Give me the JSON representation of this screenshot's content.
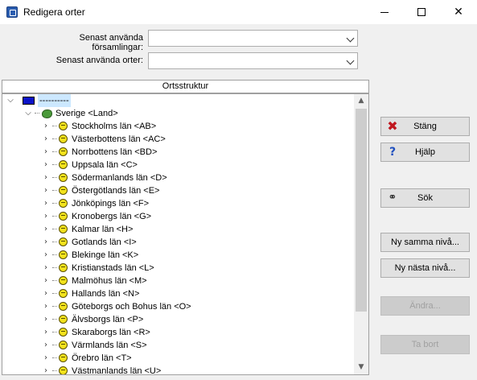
{
  "window": {
    "title": "Redigera orter",
    "app_icon": "app-icon",
    "min_icon": "minimize-icon",
    "max_icon": "maximize-icon",
    "close_icon": "close-icon"
  },
  "filters": {
    "recent_parishes_label": "Senast använda församlingar:",
    "recent_parishes_value": "",
    "recent_places_label": "Senast använda orter:",
    "recent_places_value": ""
  },
  "tree": {
    "header": "Ortsstruktur",
    "root": {
      "label": "----------",
      "icon": "blue-flag-icon"
    },
    "country": {
      "label": "Sverige <Land>",
      "icon": "country-map-icon"
    },
    "counties": [
      "Stockholms län <AB>",
      "Västerbottens län <AC>",
      "Norrbottens län <BD>",
      "Uppsala län <C>",
      "Södermanlands län <D>",
      "Östergötlands län <E>",
      "Jönköpings län <F>",
      "Kronobergs län <G>",
      "Kalmar län <H>",
      "Gotlands län <I>",
      "Blekinge län <K>",
      "Kristianstads län <L>",
      "Malmöhus län <M>",
      "Hallands län <N>",
      "Göteborgs och Bohus län <O>",
      "Älvsborgs län <P>",
      "Skaraborgs län <R>",
      "Värmlands län <S>",
      "Örebro län <T>",
      "Västmanlands län <U>"
    ]
  },
  "buttons": {
    "close": "Stäng",
    "help": "Hjälp",
    "search": "Sök",
    "new_same_level": "Ny samma nivå...",
    "new_next_level": "Ny nästa nivå...",
    "edit": "Ändra...",
    "remove": "Ta bort"
  },
  "colors": {
    "accent_close": "#c0171f",
    "accent_help": "#1f4fbf",
    "selection": "#cce8ff"
  }
}
